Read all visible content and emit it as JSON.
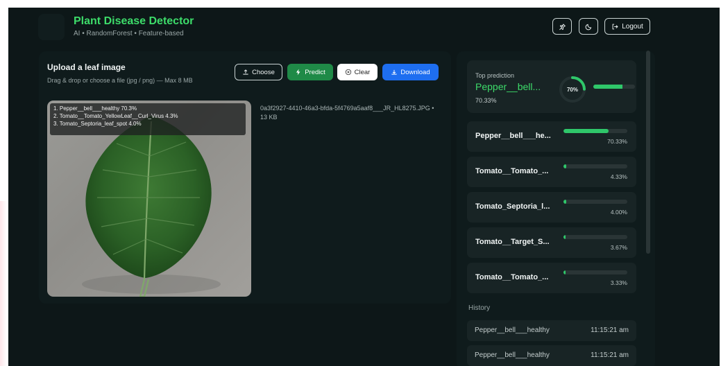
{
  "header": {
    "title": "Plant Disease Detector",
    "subtitle": "AI • RandomForest • Feature-based",
    "logout_label": "Logout",
    "icons": [
      "pin-icon",
      "moon-icon",
      "logout-icon"
    ]
  },
  "upload": {
    "title": "Upload a leaf image",
    "subtitle": "Drag & drop or choose a file (jpg / png) — Max 8 MB",
    "choose_label": "Choose",
    "predict_label": "Predict",
    "clear_label": "Clear",
    "download_label": "Download",
    "file_name": "0a3f2927-4410-46a3-bfda-5f4769a5aaf8___JR_HL8275.JPG • 13 KB",
    "overlay_lines": [
      "1. Pepper__bell___healthy 70.3%",
      "2. Tomato__Tomato_YellowLeaf__Curl_Virus 4.3%",
      "3. Tomato_Septoria_leaf_spot 4.0%"
    ]
  },
  "top_prediction": {
    "label": "Top prediction",
    "name": "Pepper__bell...",
    "percent": "70.33%",
    "gauge_text": "70%",
    "value": 70.33
  },
  "predictions": [
    {
      "name": "Pepper__bell___he...",
      "percent": "70.33%",
      "value": 70.33
    },
    {
      "name": "Tomato__Tomato_...",
      "percent": "4.33%",
      "value": 4.33
    },
    {
      "name": "Tomato_Septoria_l...",
      "percent": "4.00%",
      "value": 4.0
    },
    {
      "name": "Tomato__Target_S...",
      "percent": "3.67%",
      "value": 3.67
    },
    {
      "name": "Tomato__Tomato_...",
      "percent": "3.33%",
      "value": 3.33
    }
  ],
  "history": {
    "title": "History",
    "items": [
      {
        "name": "Pepper__bell___healthy",
        "time": "11:15:21 am"
      },
      {
        "name": "Pepper__bell___healthy",
        "time": "11:15:21 am"
      }
    ]
  },
  "colors": {
    "accent_green": "#3ddc6a",
    "bar_green": "#2fc76a",
    "predict_button": "#1f8a47",
    "download_button": "#1e6ef0",
    "background": "#0d1718"
  }
}
